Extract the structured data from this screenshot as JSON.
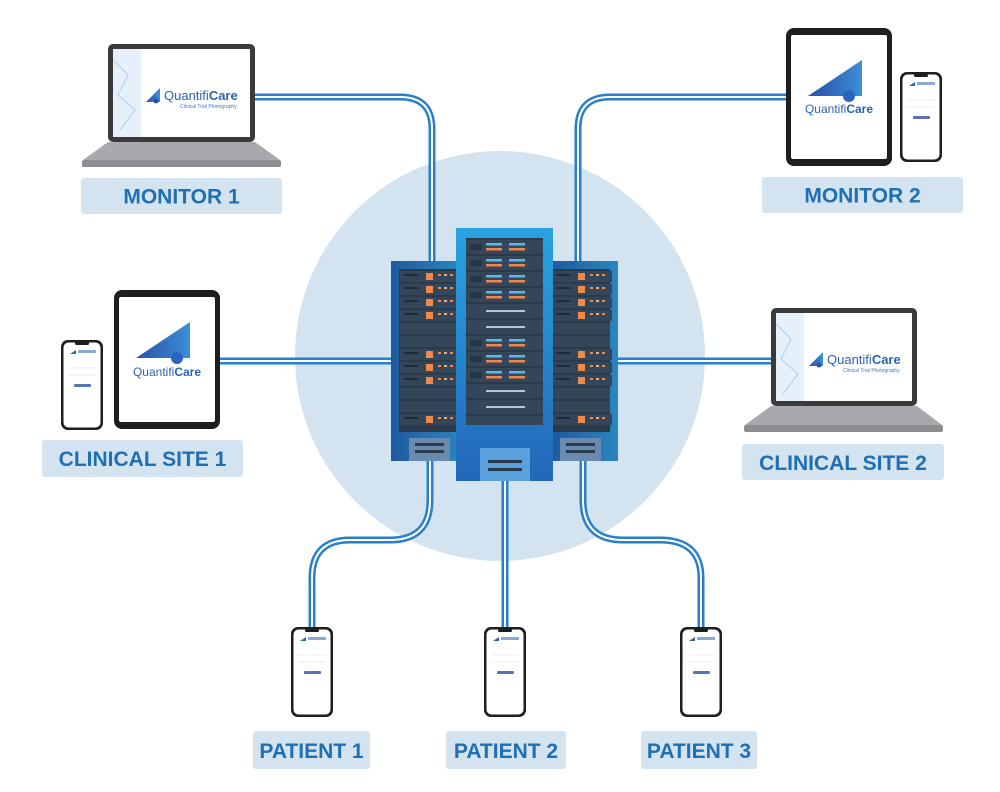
{
  "brand": {
    "name_light": "Quantifi",
    "name_bold": "Care",
    "tagline": "Clinical Trial Photography"
  },
  "nodes": {
    "monitor1": "MONITOR 1",
    "monitor2": "MONITOR 2",
    "site1": "CLINICAL SITE 1",
    "site2": "CLINICAL SITE 2",
    "patient1": "PATIENT 1",
    "patient2": "PATIENT 2",
    "patient3": "PATIENT 3"
  },
  "colors": {
    "label_text": "#1f6fb5",
    "label_bg": "#d3e3f0",
    "hub_circle": "#d3e3f0",
    "cable": "#2a7fc9",
    "server": "#2377c4"
  }
}
